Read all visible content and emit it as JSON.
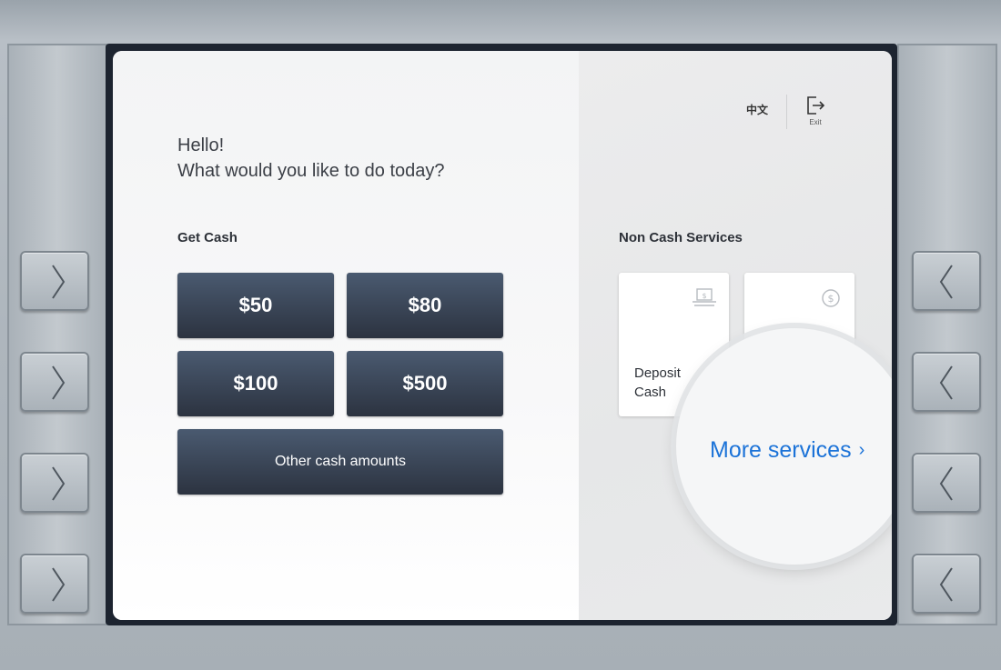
{
  "greeting": {
    "line1": "Hello!",
    "line2": "What would you like to do today?"
  },
  "get_cash": {
    "label": "Get Cash",
    "amounts": [
      "$50",
      "$80",
      "$100",
      "$500"
    ],
    "other_label": "Other cash amounts"
  },
  "header": {
    "language_label": "中文",
    "exit_label": "Exit"
  },
  "non_cash": {
    "label": "Non Cash Services",
    "cards": [
      {
        "label_line1": "Deposit",
        "label_line2": "Cash",
        "icon": "deposit-icon"
      },
      {
        "label_line1": "",
        "label_line2": "",
        "icon": "dollar-coin-icon"
      }
    ],
    "more_services_label": "More services",
    "more_services_chevron": "›"
  },
  "colors": {
    "button_top": "#4a5a70",
    "button_bottom": "#2c3340",
    "link_blue": "#1c73d8"
  },
  "icons": {
    "side_key_left": "chevron-right-icon",
    "side_key_right": "chevron-left-icon",
    "exit": "exit-door-icon"
  }
}
